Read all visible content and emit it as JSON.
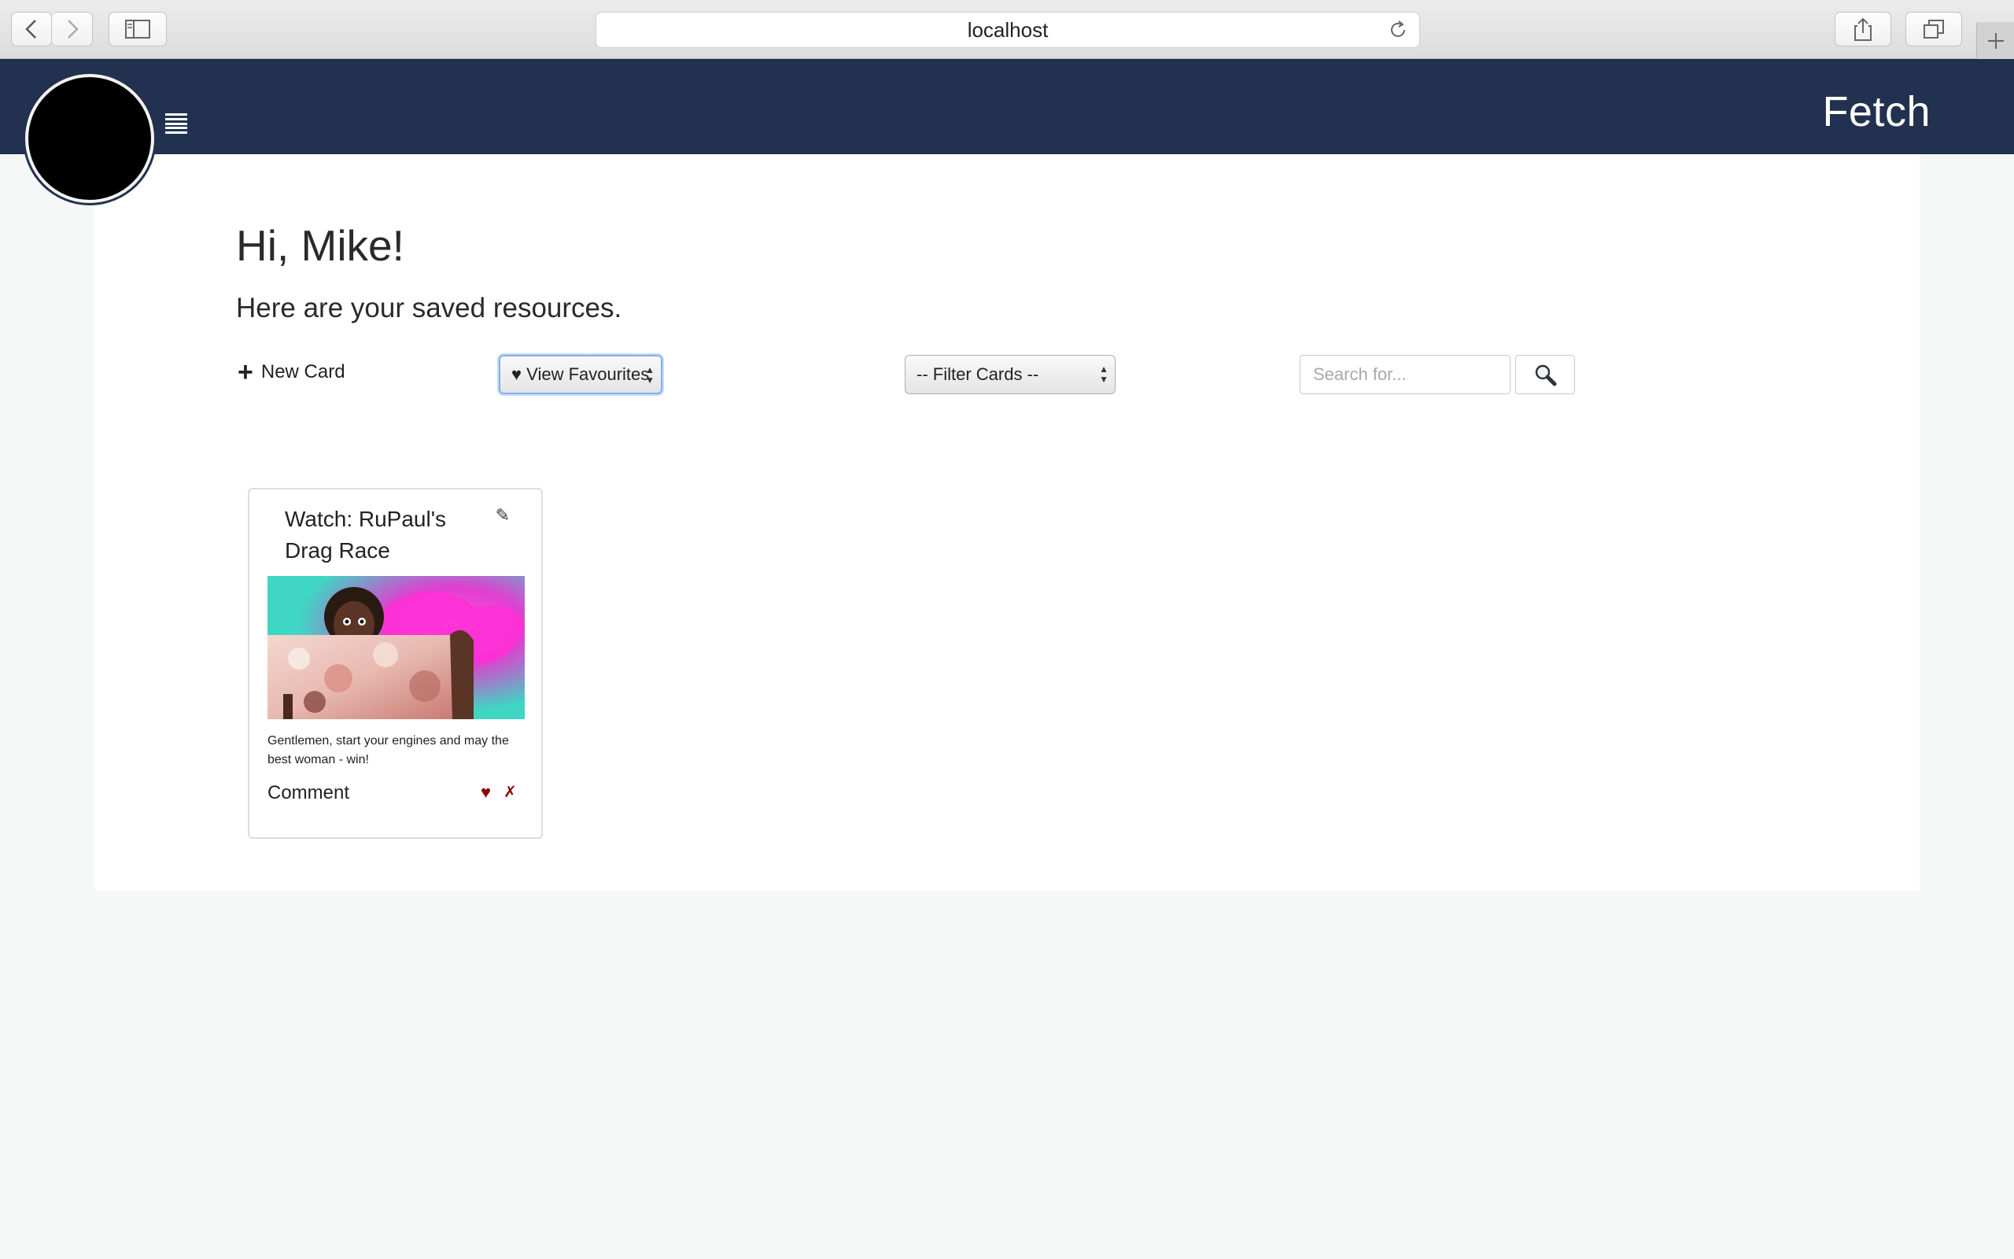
{
  "browser": {
    "url": "localhost",
    "icons": {
      "back": "chevron-left-icon",
      "forward": "chevron-right-icon",
      "sidebar": "sidebar-icon",
      "reload": "reload-icon",
      "share": "share-icon",
      "tabs": "tabs-icon",
      "new_tab": "plus-icon"
    }
  },
  "header": {
    "brand": "Fetch",
    "background": "#22314f",
    "menu_icon": "hamburger-icon"
  },
  "main": {
    "greeting": "Hi, Mike!",
    "subtitle": "Here are your saved resources."
  },
  "toolbar": {
    "new_card_label": "New Card",
    "view_favourites_label": "♥ View Favourites",
    "filter_label": "-- Filter Cards --",
    "search_placeholder": "Search for...",
    "search_icon": "magnifier-icon"
  },
  "cards": [
    {
      "title": "Watch: RuPaul's Drag Race",
      "description": "Gentlemen, start your engines and may the best woman - win!",
      "comment_label": "Comment",
      "favourite_symbol": "♥",
      "delete_symbol": "✗",
      "edit_symbol": "✎",
      "accent": "#8b0000"
    }
  ]
}
